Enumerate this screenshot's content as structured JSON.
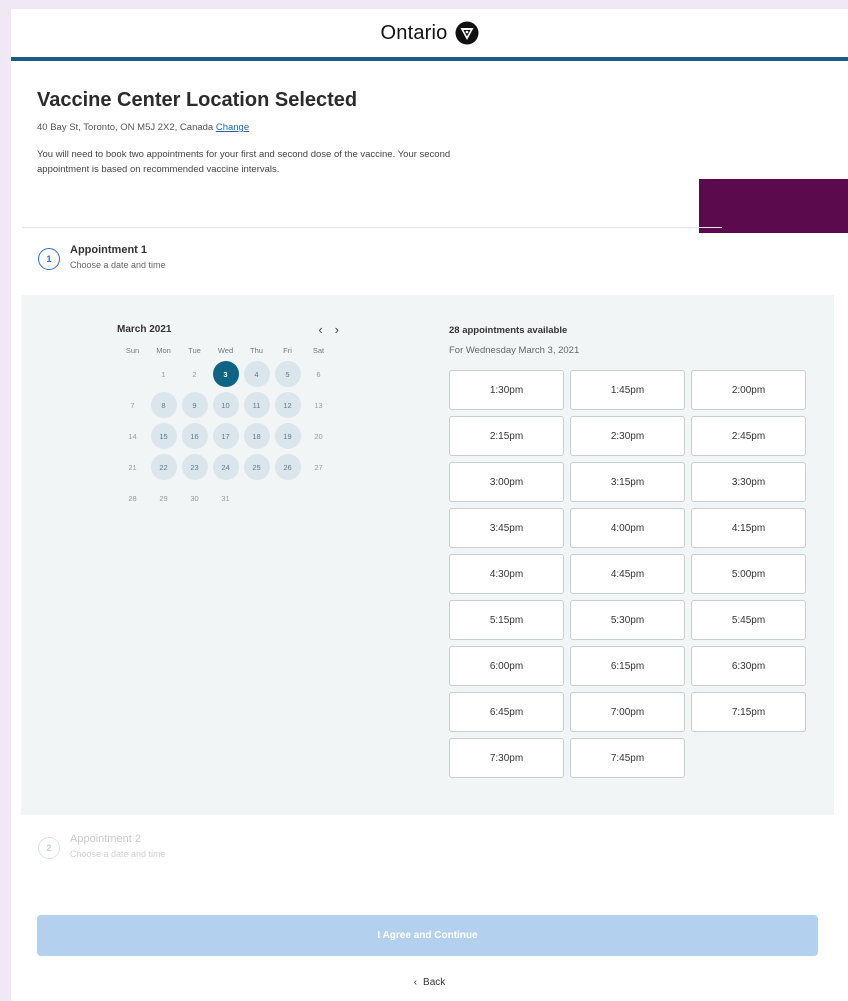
{
  "header": {
    "brand": "Ontario"
  },
  "intro": {
    "title": "Vaccine Center Location Selected",
    "address": "40 Bay St, Toronto, ON M5J 2X2, Canada",
    "change_label": "Change",
    "body": "You will need to book two appointments for your first and second dose of the vaccine. Your second appointment is based on recommended vaccine intervals."
  },
  "steps": [
    {
      "number": "1",
      "title": "Appointment 1",
      "subtitle": "Choose a date and time"
    },
    {
      "number": "2",
      "title": "Appointment 2",
      "subtitle": "Choose a date and time"
    }
  ],
  "calendar": {
    "month_label": "March 2021",
    "prev_icon": "‹",
    "next_icon": "›",
    "weekdays": [
      "Sun",
      "Mon",
      "Tue",
      "Wed",
      "Thu",
      "Fri",
      "Sat"
    ],
    "weeks": [
      [
        "",
        "1",
        "2",
        "3",
        "4",
        "5",
        "6"
      ],
      [
        "7",
        "8",
        "9",
        "10",
        "11",
        "12",
        "13"
      ],
      [
        "14",
        "15",
        "16",
        "17",
        "18",
        "19",
        "20"
      ],
      [
        "21",
        "22",
        "23",
        "24",
        "25",
        "26",
        "27"
      ],
      [
        "28",
        "29",
        "30",
        "31",
        "",
        "",
        ""
      ]
    ],
    "available_days": [
      "3",
      "4",
      "5",
      "8",
      "9",
      "10",
      "11",
      "12",
      "15",
      "16",
      "17",
      "18",
      "19",
      "22",
      "23",
      "24",
      "25",
      "26"
    ],
    "selected_day": "3"
  },
  "slots": {
    "count_label": "28 appointments available",
    "date_label": "For Wednesday March 3, 2021",
    "times": [
      "1:30pm",
      "1:45pm",
      "2:00pm",
      "2:15pm",
      "2:30pm",
      "2:45pm",
      "3:00pm",
      "3:15pm",
      "3:30pm",
      "3:45pm",
      "4:00pm",
      "4:15pm",
      "4:30pm",
      "4:45pm",
      "5:00pm",
      "5:15pm",
      "5:30pm",
      "5:45pm",
      "6:00pm",
      "6:15pm",
      "6:30pm",
      "6:45pm",
      "7:00pm",
      "7:15pm",
      "7:30pm",
      "7:45pm"
    ]
  },
  "actions": {
    "agree_label": "I Agree and Continue",
    "back_label": "Back",
    "back_icon": "‹"
  },
  "colors": {
    "header_rule": "#1a5a86",
    "selected_day": "#0f6384",
    "available_day": "#dae5ec",
    "accent_block": "#5c0a4e",
    "agree_button": "#b3d1ef"
  }
}
